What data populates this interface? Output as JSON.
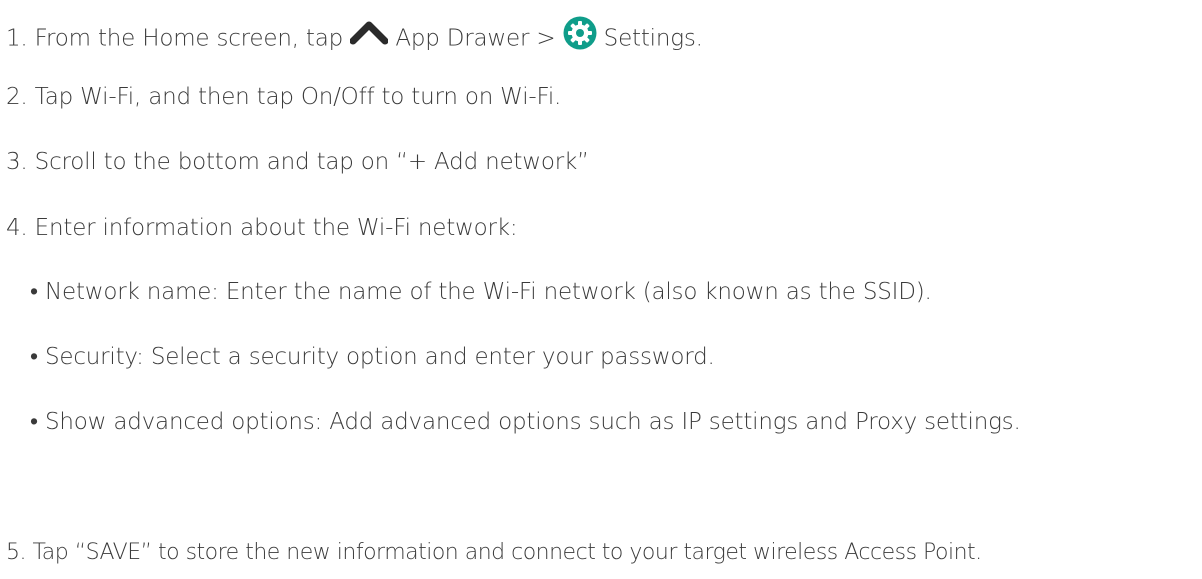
{
  "steps": [
    {
      "number": "1.",
      "parts": {
        "a": "From the Home screen, tap",
        "b": "App Drawer >",
        "c": "Settings."
      }
    },
    {
      "number": "2.",
      "text": "Tap Wi-Fi, and then tap On/Off to turn on Wi-Fi."
    },
    {
      "number": "3.",
      "text": "Scroll to the bottom and tap on “+ Add network”"
    },
    {
      "number": "4.",
      "text": "Enter information about the Wi-Fi network:"
    },
    {
      "number": "5.",
      "text": "Tap “SAVE” to store the new information and connect to your target wireless Access Point."
    }
  ],
  "bullets": [
    {
      "marker": "•",
      "text": "Network name: Enter the name of the Wi-Fi network (also known as the SSID)."
    },
    {
      "marker": "•",
      "text": "Security: Select a security option and enter your password."
    },
    {
      "marker": "•",
      "text": "Show advanced options: Add advanced options such as IP settings and Proxy settings."
    }
  ],
  "icons": {
    "app_drawer": "chevron-up-icon",
    "settings": "gear-icon"
  },
  "colors": {
    "text": "#3a3a3a",
    "settings_icon_bg": "#0f9d8a",
    "icon_fill": "#2b2b2b"
  }
}
